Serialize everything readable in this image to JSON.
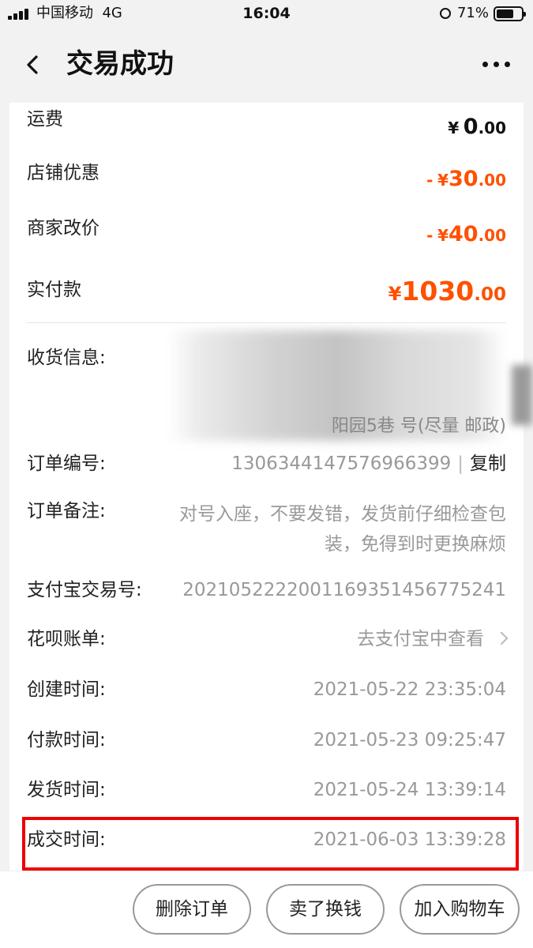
{
  "status_bar": {
    "carrier": "中国移动",
    "network": "4G",
    "time": "16:04",
    "battery": "71%",
    "battery_level": 0.71
  },
  "nav": {
    "title": "交易成功",
    "back_icon": "chevron-left-icon",
    "more_icon": "more-dots-icon"
  },
  "amounts": {
    "shipping": {
      "label": "运费",
      "sign": "",
      "symbol": "¥",
      "int": "0",
      "dec": ".00"
    },
    "shop_discount": {
      "label": "店铺优惠",
      "sign": "-",
      "symbol": "¥",
      "int": "30",
      "dec": ".00"
    },
    "merchant_adjust": {
      "label": "商家改价",
      "sign": "-",
      "symbol": "¥",
      "int": "40",
      "dec": ".00"
    },
    "paid": {
      "label": "实付款",
      "symbol": "¥",
      "int": "1030",
      "dec": ".00"
    }
  },
  "details": {
    "shipping_info": {
      "label": "收货信息:",
      "value_tail": "阳园5巷 号(尽量 邮政)"
    },
    "order_no": {
      "label": "订单编号:",
      "value": "1306344147576966399",
      "separator": "|",
      "copy": "复制"
    },
    "order_note": {
      "label": "订单备注:",
      "value": "对号入座，不要发错，发货前仔细检查包装，免得到时更换麻烦"
    },
    "alipay_no": {
      "label": "支付宝交易号:",
      "value": "2021052222001169351456775241"
    },
    "huabei": {
      "label": "花呗账单:",
      "value": "去支付宝中查看"
    },
    "created": {
      "label": "创建时间:",
      "value": "2021-05-22 23:35:04"
    },
    "paid_time": {
      "label": "付款时间:",
      "value": "2021-05-23 09:25:47"
    },
    "shipped": {
      "label": "发货时间:",
      "value": "2021-05-24 13:39:14"
    },
    "deal": {
      "label": "成交时间:",
      "value": "2021-06-03 13:39:28"
    }
  },
  "actions": {
    "delete": "删除订单",
    "resell": "卖了换钱",
    "add_cart": "加入购物车"
  },
  "colors": {
    "accent": "#ff5000",
    "highlight": "#ee0000"
  }
}
